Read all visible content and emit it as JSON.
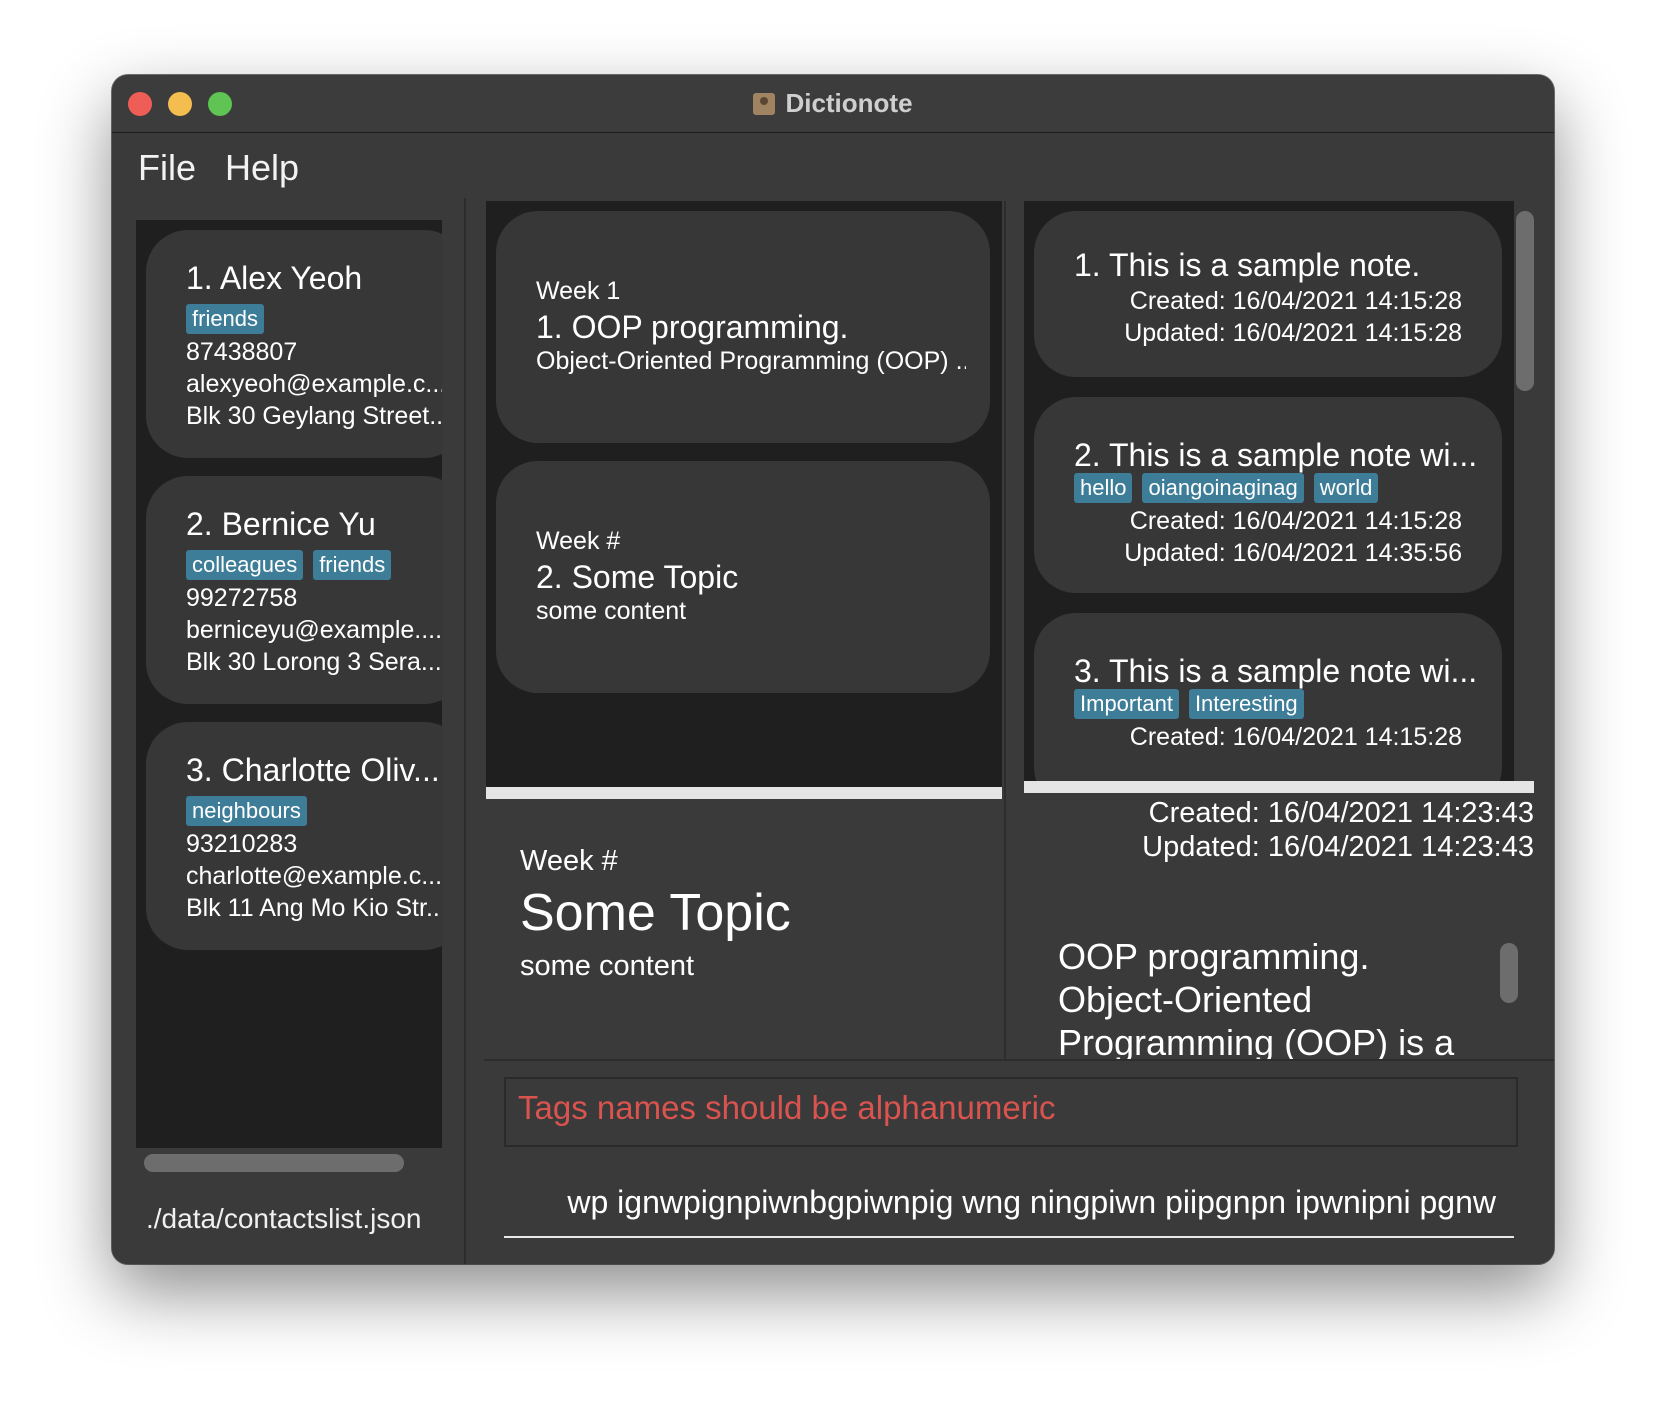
{
  "window": {
    "title": "Dictionote"
  },
  "menu": {
    "file": "File",
    "help": "Help"
  },
  "contacts": [
    {
      "title": "1.  Alex Yeoh",
      "tags": [
        "friends"
      ],
      "phone": "87438807",
      "email": "alexyeoh@example.c...",
      "address": "Blk 30 Geylang Street..."
    },
    {
      "title": "2.  Bernice Yu",
      "tags": [
        "colleagues",
        "friends"
      ],
      "phone": "99272758",
      "email": "berniceyu@example....",
      "address": "Blk 30 Lorong 3 Sera..."
    },
    {
      "title": "3.  Charlotte Oliv...",
      "tags": [
        "neighbours"
      ],
      "phone": "93210283",
      "email": "charlotte@example.c...",
      "address": "Blk 11 Ang Mo Kio Str..."
    }
  ],
  "storage_path": "./data/contactslist.json",
  "dictionary": [
    {
      "week": "Week 1",
      "title": "1.  OOP programming.",
      "content": "Object-Oriented Programming (OOP) ..."
    },
    {
      "week": "Week #",
      "title": "2.  Some Topic",
      "content": "some content"
    }
  ],
  "dictionary_detail": {
    "week": "Week #",
    "title": "Some Topic",
    "content": "some content"
  },
  "notes": [
    {
      "title": "1.  This is a sample note.",
      "tags": [],
      "created": "Created: 16/04/2021 14:15:28",
      "updated": "Updated: 16/04/2021 14:15:28"
    },
    {
      "title": "2.  This is a sample note wi...",
      "tags": [
        "hello",
        "oiangoinaginag",
        "world"
      ],
      "created": "Created: 16/04/2021 14:15:28",
      "updated": "Updated: 16/04/2021 14:35:56"
    },
    {
      "title": "3.  This is a sample note wi...",
      "tags": [
        "Important",
        "Interesting"
      ],
      "created": "Created: 16/04/2021 14:15:28",
      "updated": ""
    }
  ],
  "note_detail": {
    "created": "Created: 16/04/2021 14:23:43",
    "updated": "Updated: 16/04/2021 14:23:43",
    "body": "OOP programming. Object-Oriented Programming (OOP) is a"
  },
  "result_message": "Tags names should be alphanumeric",
  "command": {
    "value": "wp ignwpignpiwnbgpiwnpig wng ningpiwn piipgnpn ipwnipni pgnw"
  },
  "colors": {
    "tag": "#3e7d98",
    "error": "#d9534f",
    "panel": "#373737",
    "list_bg": "#1f1f1f"
  }
}
